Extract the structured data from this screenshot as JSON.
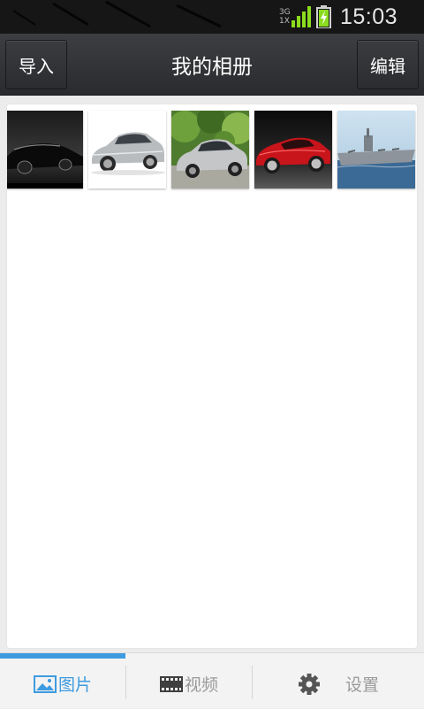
{
  "status_bar": {
    "network_type_top": "3G",
    "network_type_bottom": "1X",
    "time": "15:03"
  },
  "header": {
    "left_button": "导入",
    "title": "我的相册",
    "right_button": "编辑"
  },
  "album": {
    "photos": [
      {
        "icon": "photo-black-concept-car"
      },
      {
        "icon": "photo-silver-sedan"
      },
      {
        "icon": "photo-silver-sedan-trees"
      },
      {
        "icon": "photo-red-sports-car"
      },
      {
        "icon": "photo-aircraft-carrier"
      }
    ]
  },
  "tabs": [
    {
      "label": "图片",
      "icon": "image-icon",
      "active": true
    },
    {
      "label": "视频",
      "icon": "film-icon",
      "active": false
    },
    {
      "label": "设置",
      "icon": "gear-icon",
      "active": false
    }
  ],
  "colors": {
    "accent": "#3d9be0",
    "title_bar": "#333538",
    "status_bar": "#161616",
    "battery_green": "#8bdc1e"
  }
}
